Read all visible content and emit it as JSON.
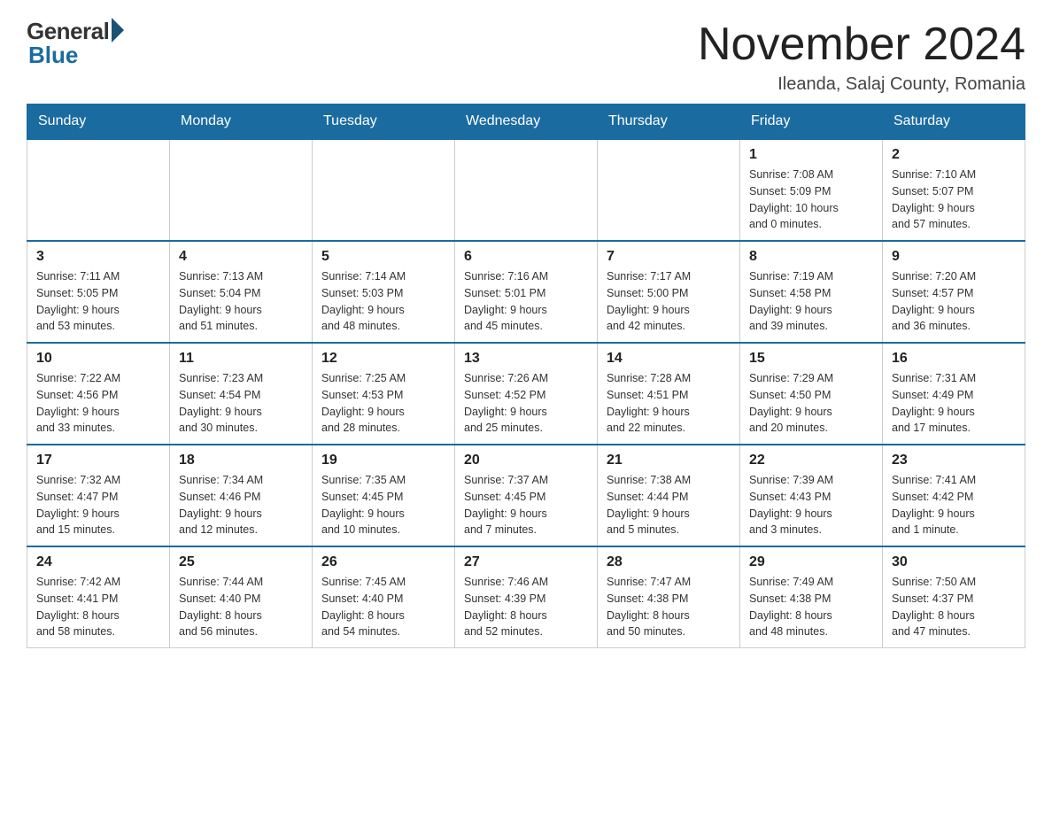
{
  "logo": {
    "general": "General",
    "blue": "Blue"
  },
  "title": "November 2024",
  "location": "Ileanda, Salaj County, Romania",
  "days_of_week": [
    "Sunday",
    "Monday",
    "Tuesday",
    "Wednesday",
    "Thursday",
    "Friday",
    "Saturday"
  ],
  "weeks": [
    [
      {
        "day": "",
        "info": ""
      },
      {
        "day": "",
        "info": ""
      },
      {
        "day": "",
        "info": ""
      },
      {
        "day": "",
        "info": ""
      },
      {
        "day": "",
        "info": ""
      },
      {
        "day": "1",
        "info": "Sunrise: 7:08 AM\nSunset: 5:09 PM\nDaylight: 10 hours\nand 0 minutes."
      },
      {
        "day": "2",
        "info": "Sunrise: 7:10 AM\nSunset: 5:07 PM\nDaylight: 9 hours\nand 57 minutes."
      }
    ],
    [
      {
        "day": "3",
        "info": "Sunrise: 7:11 AM\nSunset: 5:05 PM\nDaylight: 9 hours\nand 53 minutes."
      },
      {
        "day": "4",
        "info": "Sunrise: 7:13 AM\nSunset: 5:04 PM\nDaylight: 9 hours\nand 51 minutes."
      },
      {
        "day": "5",
        "info": "Sunrise: 7:14 AM\nSunset: 5:03 PM\nDaylight: 9 hours\nand 48 minutes."
      },
      {
        "day": "6",
        "info": "Sunrise: 7:16 AM\nSunset: 5:01 PM\nDaylight: 9 hours\nand 45 minutes."
      },
      {
        "day": "7",
        "info": "Sunrise: 7:17 AM\nSunset: 5:00 PM\nDaylight: 9 hours\nand 42 minutes."
      },
      {
        "day": "8",
        "info": "Sunrise: 7:19 AM\nSunset: 4:58 PM\nDaylight: 9 hours\nand 39 minutes."
      },
      {
        "day": "9",
        "info": "Sunrise: 7:20 AM\nSunset: 4:57 PM\nDaylight: 9 hours\nand 36 minutes."
      }
    ],
    [
      {
        "day": "10",
        "info": "Sunrise: 7:22 AM\nSunset: 4:56 PM\nDaylight: 9 hours\nand 33 minutes."
      },
      {
        "day": "11",
        "info": "Sunrise: 7:23 AM\nSunset: 4:54 PM\nDaylight: 9 hours\nand 30 minutes."
      },
      {
        "day": "12",
        "info": "Sunrise: 7:25 AM\nSunset: 4:53 PM\nDaylight: 9 hours\nand 28 minutes."
      },
      {
        "day": "13",
        "info": "Sunrise: 7:26 AM\nSunset: 4:52 PM\nDaylight: 9 hours\nand 25 minutes."
      },
      {
        "day": "14",
        "info": "Sunrise: 7:28 AM\nSunset: 4:51 PM\nDaylight: 9 hours\nand 22 minutes."
      },
      {
        "day": "15",
        "info": "Sunrise: 7:29 AM\nSunset: 4:50 PM\nDaylight: 9 hours\nand 20 minutes."
      },
      {
        "day": "16",
        "info": "Sunrise: 7:31 AM\nSunset: 4:49 PM\nDaylight: 9 hours\nand 17 minutes."
      }
    ],
    [
      {
        "day": "17",
        "info": "Sunrise: 7:32 AM\nSunset: 4:47 PM\nDaylight: 9 hours\nand 15 minutes."
      },
      {
        "day": "18",
        "info": "Sunrise: 7:34 AM\nSunset: 4:46 PM\nDaylight: 9 hours\nand 12 minutes."
      },
      {
        "day": "19",
        "info": "Sunrise: 7:35 AM\nSunset: 4:45 PM\nDaylight: 9 hours\nand 10 minutes."
      },
      {
        "day": "20",
        "info": "Sunrise: 7:37 AM\nSunset: 4:45 PM\nDaylight: 9 hours\nand 7 minutes."
      },
      {
        "day": "21",
        "info": "Sunrise: 7:38 AM\nSunset: 4:44 PM\nDaylight: 9 hours\nand 5 minutes."
      },
      {
        "day": "22",
        "info": "Sunrise: 7:39 AM\nSunset: 4:43 PM\nDaylight: 9 hours\nand 3 minutes."
      },
      {
        "day": "23",
        "info": "Sunrise: 7:41 AM\nSunset: 4:42 PM\nDaylight: 9 hours\nand 1 minute."
      }
    ],
    [
      {
        "day": "24",
        "info": "Sunrise: 7:42 AM\nSunset: 4:41 PM\nDaylight: 8 hours\nand 58 minutes."
      },
      {
        "day": "25",
        "info": "Sunrise: 7:44 AM\nSunset: 4:40 PM\nDaylight: 8 hours\nand 56 minutes."
      },
      {
        "day": "26",
        "info": "Sunrise: 7:45 AM\nSunset: 4:40 PM\nDaylight: 8 hours\nand 54 minutes."
      },
      {
        "day": "27",
        "info": "Sunrise: 7:46 AM\nSunset: 4:39 PM\nDaylight: 8 hours\nand 52 minutes."
      },
      {
        "day": "28",
        "info": "Sunrise: 7:47 AM\nSunset: 4:38 PM\nDaylight: 8 hours\nand 50 minutes."
      },
      {
        "day": "29",
        "info": "Sunrise: 7:49 AM\nSunset: 4:38 PM\nDaylight: 8 hours\nand 48 minutes."
      },
      {
        "day": "30",
        "info": "Sunrise: 7:50 AM\nSunset: 4:37 PM\nDaylight: 8 hours\nand 47 minutes."
      }
    ]
  ]
}
